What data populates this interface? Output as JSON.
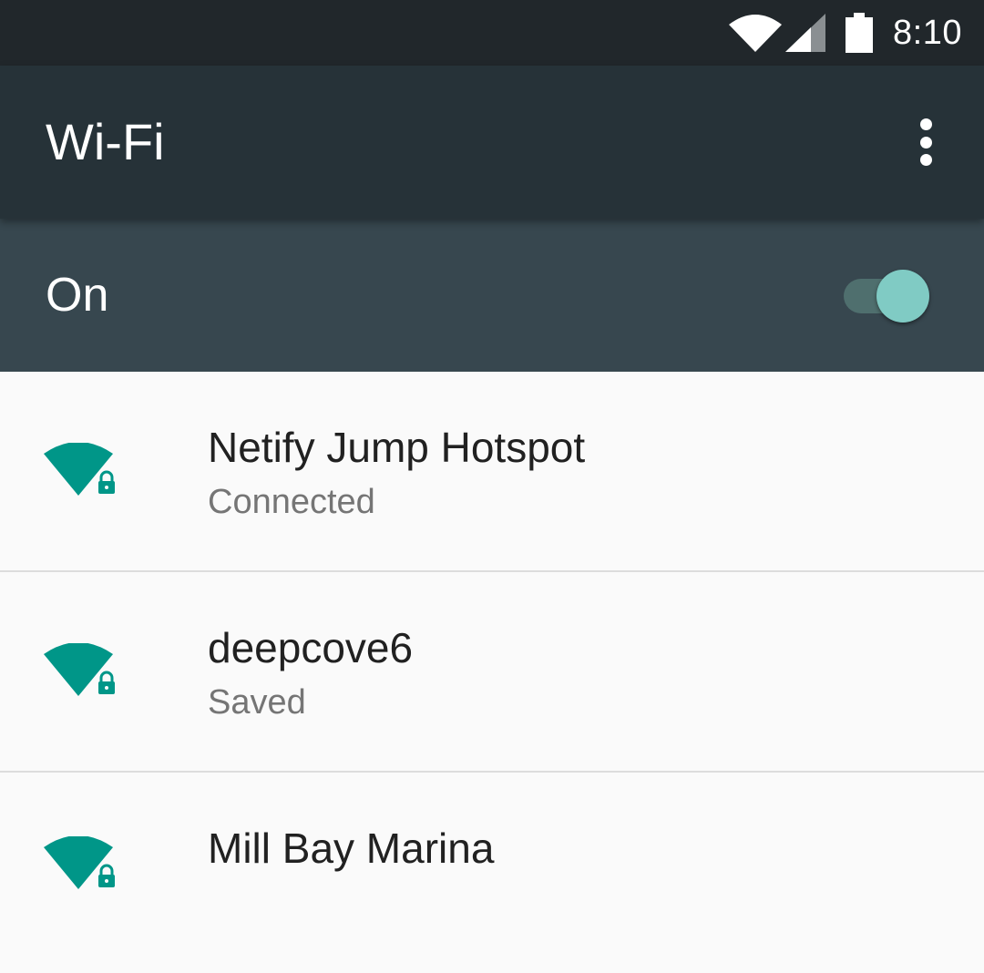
{
  "status_bar": {
    "time": "8:10",
    "icons": [
      "wifi-signal-icon",
      "cellular-signal-icon",
      "battery-icon"
    ]
  },
  "app_bar": {
    "title": "Wi-Fi",
    "overflow_icon": "more-vert-icon"
  },
  "master_switch": {
    "label": "On",
    "state": "on"
  },
  "networks": [
    {
      "name": "Netify Jump Hotspot",
      "status": "Connected",
      "icon": "wifi-lock-icon",
      "secured": true
    },
    {
      "name": "deepcove6",
      "status": "Saved",
      "icon": "wifi-lock-icon",
      "secured": true
    },
    {
      "name": "Mill Bay Marina",
      "status": "",
      "icon": "wifi-lock-icon",
      "secured": true
    }
  ],
  "colors": {
    "status_bar": "#21272b",
    "app_bar": "#263238",
    "switch_bar": "#37474f",
    "accent": "#009688",
    "toggle_thumb": "#80cbc4",
    "list_background": "#fafafa"
  }
}
